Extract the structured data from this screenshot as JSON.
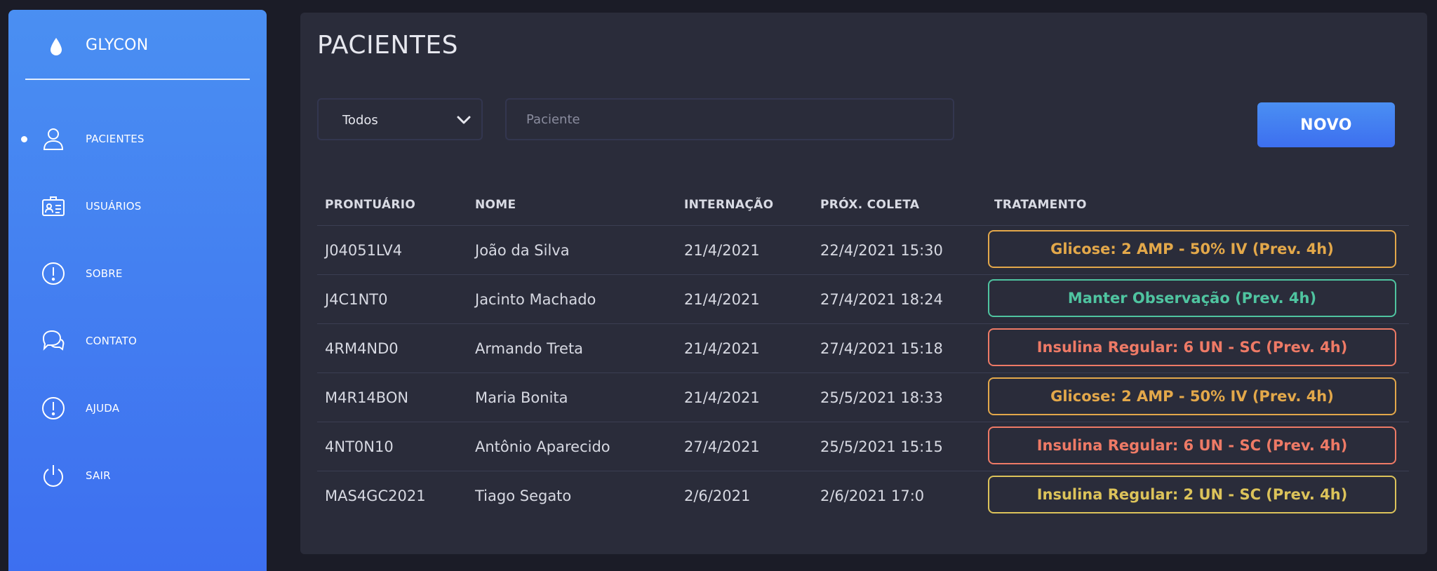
{
  "app": {
    "name": "GLYCON"
  },
  "sidebar": {
    "items": [
      {
        "label": "PACIENTES",
        "icon": "user-icon",
        "active": true
      },
      {
        "label": "USUÁRIOS",
        "icon": "id-card-icon",
        "active": false
      },
      {
        "label": "SOBRE",
        "icon": "info-circle-icon",
        "active": false
      },
      {
        "label": "CONTATO",
        "icon": "chat-bubbles-icon",
        "active": false
      },
      {
        "label": "AJUDA",
        "icon": "help-circle-icon",
        "active": false
      },
      {
        "label": "SAIR",
        "icon": "power-icon",
        "active": false
      }
    ]
  },
  "main": {
    "title": "PACIENTES",
    "filter": {
      "selected": "Todos"
    },
    "search": {
      "placeholder": "Paciente",
      "value": ""
    },
    "new_button": "NOVO",
    "table": {
      "headers": {
        "prontuario": "PRONTUÁRIO",
        "nome": "NOME",
        "internacao": "INTERNAÇÃO",
        "proxima_coleta": "PRÓX. COLETA",
        "tratamento": "TRATAMENTO"
      },
      "rows": [
        {
          "prontuario": "J04051LV4",
          "nome": "João da Silva",
          "internacao": "21/4/2021",
          "proxima_coleta": "22/4/2021 15:30",
          "tratamento": "Glicose: 2 AMP - 50% IV (Prev. 4h)",
          "status_color": "#e3a84a"
        },
        {
          "prontuario": "J4C1NT0",
          "nome": "Jacinto Machado",
          "internacao": "21/4/2021",
          "proxima_coleta": "27/4/2021 18:24",
          "tratamento": "Manter Observação (Prev. 4h)",
          "status_color": "#4fc4a0"
        },
        {
          "prontuario": "4RM4ND0",
          "nome": "Armando Treta",
          "internacao": "21/4/2021",
          "proxima_coleta": "27/4/2021 15:18",
          "tratamento": "Insulina Regular: 6 UN - SC (Prev. 4h)",
          "status_color": "#ee7a66"
        },
        {
          "prontuario": "M4R14BON",
          "nome": "Maria Bonita",
          "internacao": "21/4/2021",
          "proxima_coleta": "25/5/2021 18:33",
          "tratamento": "Glicose: 2 AMP - 50% IV (Prev. 4h)",
          "status_color": "#e3a84a"
        },
        {
          "prontuario": "4NT0N10",
          "nome": "Antônio Aparecido",
          "internacao": "27/4/2021",
          "proxima_coleta": "25/5/2021 15:15",
          "tratamento": "Insulina Regular: 6 UN - SC (Prev. 4h)",
          "status_color": "#ee7a66"
        },
        {
          "prontuario": "MAS4GC2021",
          "nome": "Tiago Segato",
          "internacao": "2/6/2021",
          "proxima_coleta": "2/6/2021 17:0",
          "tratamento": "Insulina Regular: 2 UN - SC (Prev. 4h)",
          "status_color": "#dcc35a"
        }
      ]
    }
  }
}
